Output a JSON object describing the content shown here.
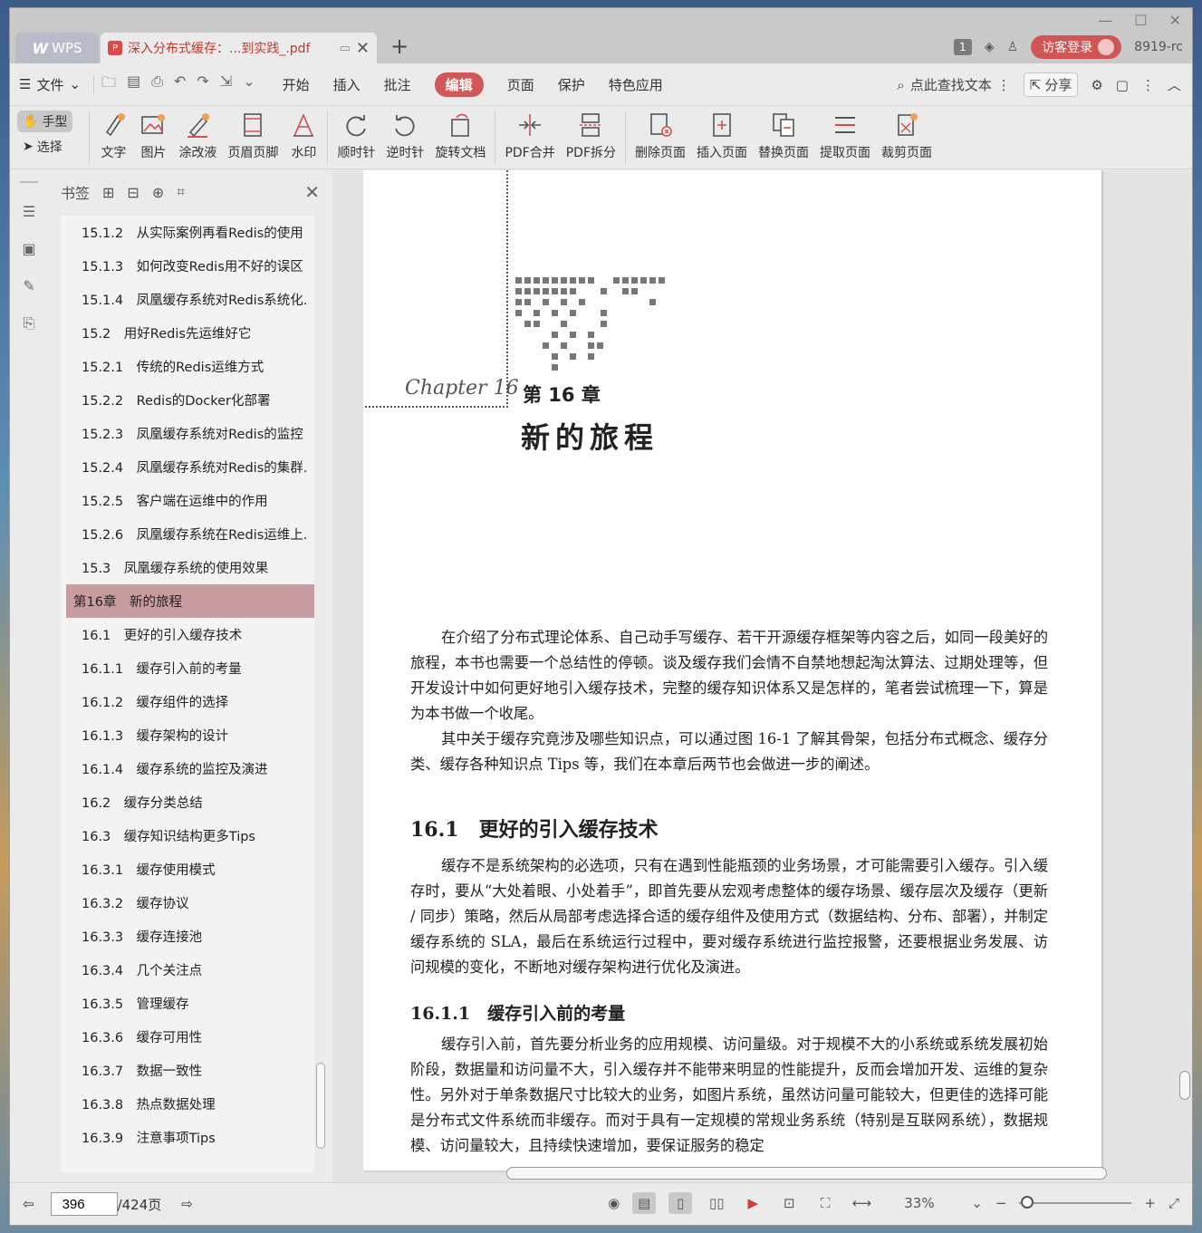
{
  "titlebar": {
    "app_name": "WPS",
    "doc_tab_title": "深入分布式缓存：...到实践_.pdf",
    "page_badge": "1",
    "login_label": "访客登录",
    "user_id": "8919-rc"
  },
  "menubar": {
    "file_label": "文件",
    "tabs": [
      "开始",
      "插入",
      "批注",
      "编辑",
      "页面",
      "保护",
      "特色应用"
    ],
    "active_tab": "编辑",
    "search_label": "点此查找文本",
    "share_label": "分享"
  },
  "ribbon": {
    "hand_label": "手型",
    "select_label": "选择",
    "buttons": [
      "文字",
      "图片",
      "涂改液",
      "页眉页脚",
      "水印",
      "顺时针",
      "逆时针",
      "旋转文档",
      "PDF合并",
      "PDF拆分",
      "删除页面",
      "插入页面",
      "替换页面",
      "提取页面",
      "裁剪页面"
    ]
  },
  "bookmarks": {
    "title": "书签",
    "items": [
      "15.1.2　从实际案例再看Redis的使用",
      "15.1.3　如何改变Redis用不好的误区",
      "15.1.4　凤凰缓存系统对Redis系统化...",
      "15.2　用好Redis先运维好它",
      "15.2.1　传统的Redis运维方式",
      "15.2.2　Redis的Docker化部署",
      "15.2.3　凤凰缓存系统对Redis的监控",
      "15.2.4　凤凰缓存系统对Redis的集群...",
      "15.2.5　客户端在运维中的作用",
      "15.2.6　凤凰缓存系统在Redis运维上...",
      "15.3　凤凰缓存系统的使用效果",
      "第16章　新的旅程",
      "16.1　更好的引入缓存技术",
      "16.1.1　缓存引入前的考量",
      "16.1.2　缓存组件的选择",
      "16.1.3　缓存架构的设计",
      "16.1.4　缓存系统的监控及演进",
      "16.2　缓存分类总结",
      "16.3　缓存知识结构更多Tips",
      "16.3.1　缓存使用模式",
      "16.3.2　缓存协议",
      "16.3.3　缓存连接池",
      "16.3.4　几个关注点",
      "16.3.5　管理缓存",
      "16.3.6　缓存可用性",
      "16.3.7　数据一致性",
      "16.3.8　热点数据处理",
      "16.3.9　注意事项Tips"
    ],
    "selected_index": 11
  },
  "page": {
    "chapter_script": "Chapter 16",
    "chapter_number": "第 16 章",
    "chapter_title": "新的旅程",
    "intro_p1": "在介绍了分布式理论体系、自己动手写缓存、若干开源缓存框架等内容之后，如同一段美好的旅程，本书也需要一个总结性的停顿。谈及缓存我们会情不自禁地想起淘汰算法、过期处理等，但开发设计中如何更好地引入缓存技术，完整的缓存知识体系又是怎样的，笔者尝试梳理一下，算是为本书做一个收尾。",
    "intro_p2": "其中关于缓存究竟涉及哪些知识点，可以通过图 16-1 了解其骨架，包括分布式概念、缓存分类、缓存各种知识点 Tips 等，我们在本章后两节也会做进一步的阐述。",
    "sec_16_1": "16.1　更好的引入缓存技术",
    "sec_16_1_p": "缓存不是系统架构的必选项，只有在遇到性能瓶颈的业务场景，才可能需要引入缓存。引入缓存时，要从“大处着眼、小处着手”，即首先要从宏观考虑整体的缓存场景、缓存层次及缓存（更新 / 同步）策略，然后从局部考虑选择合适的缓存组件及使用方式（数据结构、分布、部署），并制定缓存系统的 SLA，最后在系统运行过程中，要对缓存系统进行监控报警，还要根据业务发展、访问规模的变化，不断地对缓存架构进行优化及演进。",
    "sec_16_1_1": "16.1.1　缓存引入前的考量",
    "sec_16_1_1_p": "缓存引入前，首先要分析业务的应用规模、访问量级。对于规模不大的小系统或系统发展初始阶段，数据量和访问量不大，引入缓存并不能带来明显的性能提升，反而会增加开发、运维的复杂性。另外对于单条数据尺寸比较大的业务，如图片系统，虽然访问量可能较大，但更佳的选择可能是分布式文件系统而非缓存。而对于具有一定规模的常规业务系统（特别是互联网系统），数据规模、访问量较大，且持续快速增加，要保证服务的稳定"
  },
  "status": {
    "current_page": "396",
    "total_pages": "/424页",
    "zoom": "33%"
  }
}
